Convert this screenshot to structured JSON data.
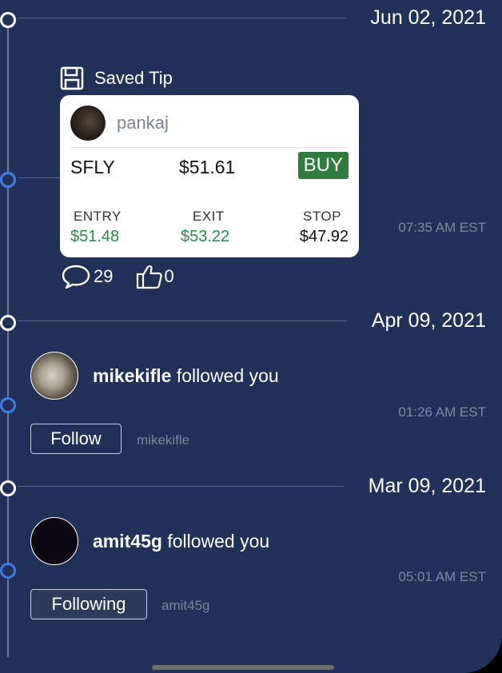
{
  "feed": {
    "groups": [
      {
        "date": "Jun 02, 2021",
        "time": "07:35 AM  EST",
        "saved_tip_label": "Saved Tip",
        "card": {
          "username": "pankaj",
          "symbol": "SFLY",
          "price": "$51.61",
          "action": "BUY",
          "entry_label": "ENTRY",
          "entry_value": "$51.48",
          "exit_label": "EXIT",
          "exit_value": "$53.22",
          "stop_label": "STOP",
          "stop_value": "$47.92"
        },
        "comments": "29",
        "likes": "0"
      },
      {
        "date": "Apr 09, 2021",
        "time": "01:26 AM  EST",
        "user": "mikekifle",
        "message": " followed you",
        "button": "Follow",
        "handle": "mikekifle"
      },
      {
        "date": "Mar 09, 2021",
        "time": "05:01 AM  EST",
        "user": "amit45g",
        "message": " followed you",
        "button": "Following",
        "handle": "amit45g"
      }
    ]
  },
  "colors": {
    "background": "#22315a",
    "accent_blue": "#3f7de6",
    "buy_green": "#2e7d3e",
    "price_green": "#2e8a46"
  },
  "icons": [
    "save-icon",
    "comment-icon",
    "thumbs-up-icon"
  ]
}
